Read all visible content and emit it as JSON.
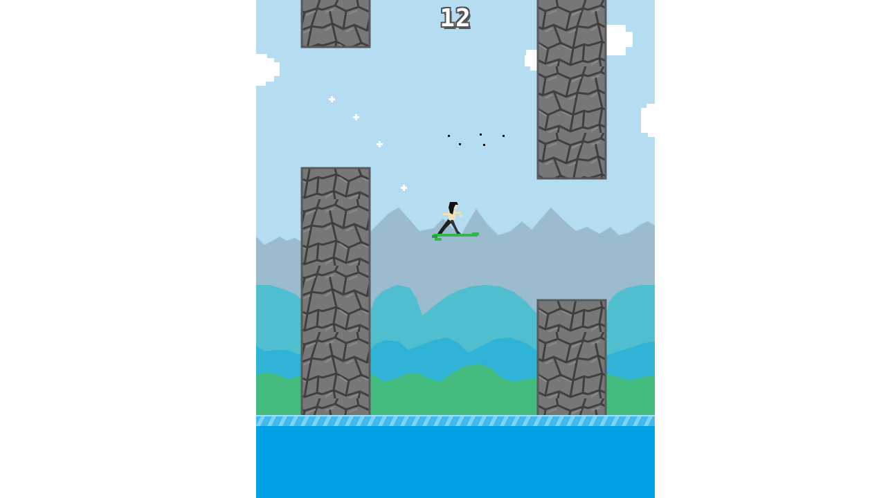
{
  "game": {
    "score": "12",
    "colors": {
      "sky": "#b4ddf1",
      "cloud": "#ffffff",
      "mountain": "#9bbccf",
      "hill_back": "#4fbecf",
      "hill_mid": "#2eb2d6",
      "hill_front": "#43bb7f",
      "water": "#00a2e6",
      "water_stripe": "#5ec8f2",
      "pillar": "#6f6f6f",
      "pillar_lines": "#3d3d3d",
      "board": "#33b54a"
    }
  }
}
